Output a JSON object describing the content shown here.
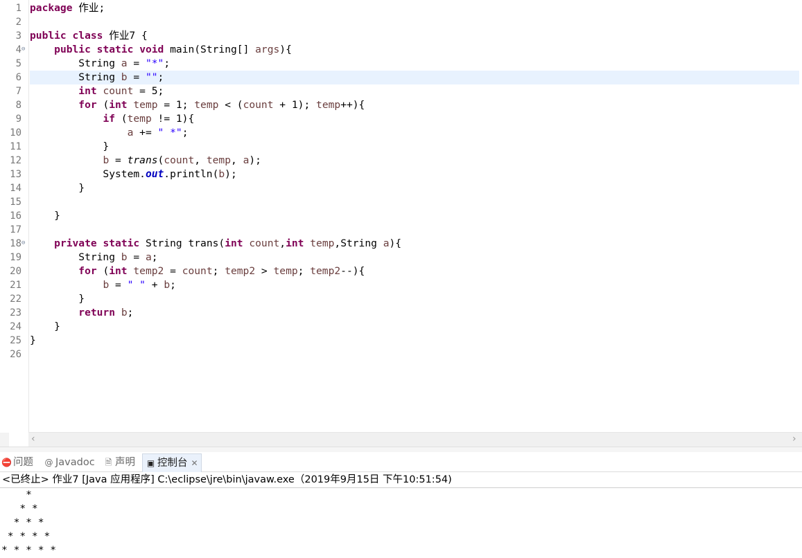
{
  "editor": {
    "line_numbers": [
      "1",
      "2",
      "3",
      "4",
      "5",
      "6",
      "7",
      "8",
      "9",
      "10",
      "11",
      "12",
      "13",
      "14",
      "15",
      "16",
      "17",
      "18",
      "19",
      "20",
      "21",
      "22",
      "23",
      "24",
      "25",
      "26"
    ],
    "current_line": 6,
    "fold_lines": [
      4,
      18
    ],
    "lines": [
      [
        {
          "t": "package",
          "c": "kw"
        },
        {
          "t": " 作业;"
        }
      ],
      [],
      [
        {
          "t": "public",
          "c": "kw"
        },
        {
          "t": " "
        },
        {
          "t": "class",
          "c": "kw"
        },
        {
          "t": " 作业7 {"
        }
      ],
      [
        {
          "t": "    "
        },
        {
          "t": "public",
          "c": "kw"
        },
        {
          "t": " "
        },
        {
          "t": "static",
          "c": "kw"
        },
        {
          "t": " "
        },
        {
          "t": "void",
          "c": "kw"
        },
        {
          "t": " main(String[] "
        },
        {
          "t": "args",
          "c": "var"
        },
        {
          "t": "){"
        }
      ],
      [
        {
          "t": "        String "
        },
        {
          "t": "a",
          "c": "var"
        },
        {
          "t": " = "
        },
        {
          "t": "\"*\"",
          "c": "str"
        },
        {
          "t": ";"
        }
      ],
      [
        {
          "t": "        String "
        },
        {
          "t": "b",
          "c": "var"
        },
        {
          "t": " = "
        },
        {
          "t": "\"\"",
          "c": "str"
        },
        {
          "t": ";"
        }
      ],
      [
        {
          "t": "        "
        },
        {
          "t": "int",
          "c": "kw"
        },
        {
          "t": " "
        },
        {
          "t": "count",
          "c": "var"
        },
        {
          "t": " = 5;"
        }
      ],
      [
        {
          "t": "        "
        },
        {
          "t": "for",
          "c": "kw"
        },
        {
          "t": " ("
        },
        {
          "t": "int",
          "c": "kw"
        },
        {
          "t": " "
        },
        {
          "t": "temp",
          "c": "var"
        },
        {
          "t": " = 1; "
        },
        {
          "t": "temp",
          "c": "var"
        },
        {
          "t": " < ("
        },
        {
          "t": "count",
          "c": "var"
        },
        {
          "t": " + 1); "
        },
        {
          "t": "temp",
          "c": "var"
        },
        {
          "t": "++){"
        }
      ],
      [
        {
          "t": "            "
        },
        {
          "t": "if",
          "c": "kw"
        },
        {
          "t": " ("
        },
        {
          "t": "temp",
          "c": "var"
        },
        {
          "t": " != 1){"
        }
      ],
      [
        {
          "t": "                "
        },
        {
          "t": "a",
          "c": "var"
        },
        {
          "t": " += "
        },
        {
          "t": "\" *\"",
          "c": "str"
        },
        {
          "t": ";"
        }
      ],
      [
        {
          "t": "            }"
        }
      ],
      [
        {
          "t": "            "
        },
        {
          "t": "b",
          "c": "var"
        },
        {
          "t": " = "
        },
        {
          "t": "trans",
          "c": "itl"
        },
        {
          "t": "("
        },
        {
          "t": "count",
          "c": "var"
        },
        {
          "t": ", "
        },
        {
          "t": "temp",
          "c": "var"
        },
        {
          "t": ", "
        },
        {
          "t": "a",
          "c": "var"
        },
        {
          "t": ");"
        }
      ],
      [
        {
          "t": "            System."
        },
        {
          "t": "out",
          "c": "fld"
        },
        {
          "t": ".println("
        },
        {
          "t": "b",
          "c": "var"
        },
        {
          "t": ");"
        }
      ],
      [
        {
          "t": "        }"
        }
      ],
      [],
      [
        {
          "t": "    }"
        }
      ],
      [],
      [
        {
          "t": "    "
        },
        {
          "t": "private",
          "c": "kw"
        },
        {
          "t": " "
        },
        {
          "t": "static",
          "c": "kw"
        },
        {
          "t": " String trans("
        },
        {
          "t": "int",
          "c": "kw"
        },
        {
          "t": " "
        },
        {
          "t": "count",
          "c": "var"
        },
        {
          "t": ","
        },
        {
          "t": "int",
          "c": "kw"
        },
        {
          "t": " "
        },
        {
          "t": "temp",
          "c": "var"
        },
        {
          "t": ",String "
        },
        {
          "t": "a",
          "c": "var"
        },
        {
          "t": "){"
        }
      ],
      [
        {
          "t": "        String "
        },
        {
          "t": "b",
          "c": "var"
        },
        {
          "t": " = "
        },
        {
          "t": "a",
          "c": "var"
        },
        {
          "t": ";"
        }
      ],
      [
        {
          "t": "        "
        },
        {
          "t": "for",
          "c": "kw"
        },
        {
          "t": " ("
        },
        {
          "t": "int",
          "c": "kw"
        },
        {
          "t": " "
        },
        {
          "t": "temp2",
          "c": "var"
        },
        {
          "t": " = "
        },
        {
          "t": "count",
          "c": "var"
        },
        {
          "t": "; "
        },
        {
          "t": "temp2",
          "c": "var"
        },
        {
          "t": " > "
        },
        {
          "t": "temp",
          "c": "var"
        },
        {
          "t": "; "
        },
        {
          "t": "temp2",
          "c": "var"
        },
        {
          "t": "--){"
        }
      ],
      [
        {
          "t": "            "
        },
        {
          "t": "b",
          "c": "var"
        },
        {
          "t": " = "
        },
        {
          "t": "\" \"",
          "c": "str"
        },
        {
          "t": " + "
        },
        {
          "t": "b",
          "c": "var"
        },
        {
          "t": ";"
        }
      ],
      [
        {
          "t": "        }"
        }
      ],
      [
        {
          "t": "        "
        },
        {
          "t": "return",
          "c": "kw"
        },
        {
          "t": " "
        },
        {
          "t": "b",
          "c": "var"
        },
        {
          "t": ";"
        }
      ],
      [
        {
          "t": "    }"
        }
      ],
      [
        {
          "t": "}"
        }
      ],
      []
    ]
  },
  "panel": {
    "tabs": [
      {
        "label": "问题",
        "icon": "problems-icon",
        "glyph": "⛔",
        "active": false
      },
      {
        "label": "Javadoc",
        "icon": "at-icon",
        "glyph": "@",
        "active": false
      },
      {
        "label": "声明",
        "icon": "declaration-icon",
        "glyph": "🗎",
        "active": false
      },
      {
        "label": "控制台",
        "icon": "console-icon",
        "glyph": "▣",
        "active": true
      }
    ],
    "close_glyph": "✕",
    "console_header": "<已终止> 作业7 [Java 应用程序] C:\\eclipse\\jre\\bin\\javaw.exe（2019年9月15日 下午10:51:54)",
    "console_output": [
      "    *",
      "   * *",
      "  * * *",
      " * * * *",
      "* * * * *"
    ]
  },
  "scroll": {
    "left_arrow": "‹",
    "right_arrow": "›"
  },
  "colors": {
    "keyword": "#7f0055",
    "string": "#2a00ff",
    "variable": "#6a3e3e",
    "field": "#0000c0",
    "current_line": "#e8f2fe",
    "change_bar": "#5a8fb0"
  }
}
